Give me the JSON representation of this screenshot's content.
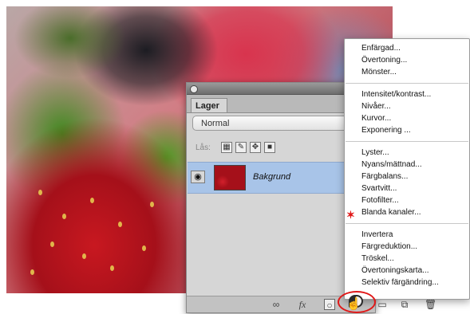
{
  "layers_panel": {
    "tab_label": "Lager",
    "blend_mode": "Normal",
    "lock_label": "Lås:",
    "layer": {
      "name": "Bakgrund"
    },
    "footer_icons": [
      "link-icon",
      "fx-icon",
      "mask-icon",
      "adjustment-layer-icon",
      "group-icon",
      "new-layer-icon",
      "trash-icon"
    ]
  },
  "adjustment_menu": {
    "groups": [
      [
        "Enfärgad...",
        "Övertoning...",
        "Mönster..."
      ],
      [
        "Intensitet/kontrast...",
        "Nivåer...",
        "Kurvor...",
        "Exponering ..."
      ],
      [
        "Lyster...",
        "Nyans/mättnad...",
        "Färgbalans...",
        "Svartvitt...",
        "Fotofilter...",
        "Blanda kanaler..."
      ],
      [
        "Invertera",
        "Färgreduktion...",
        "Tröskel...",
        "Övertoningskarta...",
        "Selektiv färgändring..."
      ]
    ],
    "annotation_color": "#e01818"
  }
}
